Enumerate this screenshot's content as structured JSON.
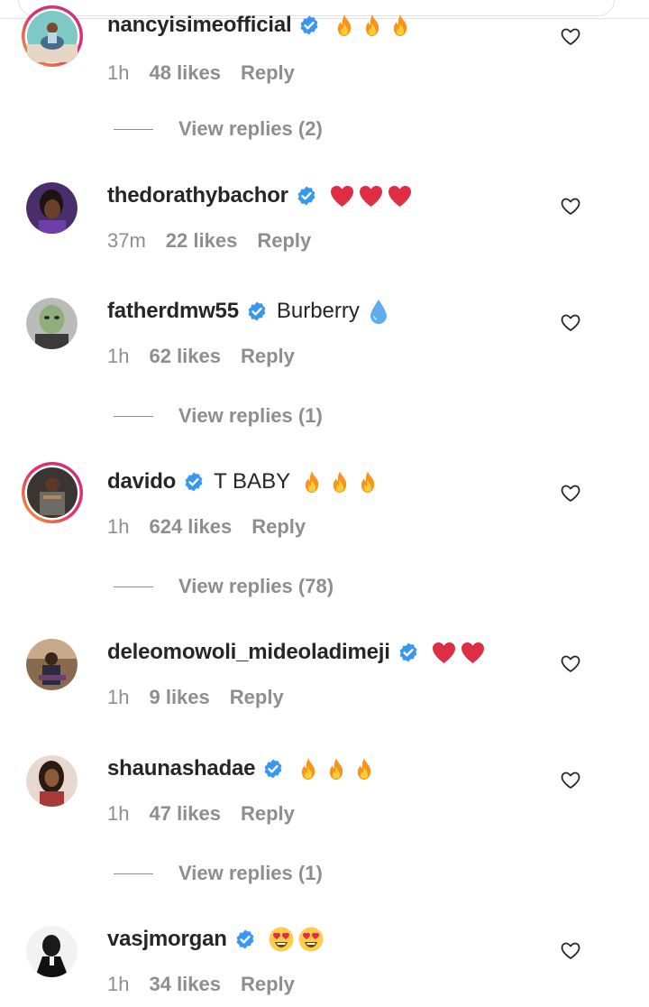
{
  "colors": {
    "text": "#262626",
    "muted": "#8e8e8e",
    "verified": "#3897f0",
    "ring": "#d6249f"
  },
  "comments": [
    {
      "username": "nancyisimeofficial",
      "verified": true,
      "text": "",
      "emojis": [
        "fire",
        "fire",
        "fire"
      ],
      "time": "1h",
      "likes": "48 likes",
      "reply": "Reply",
      "view_replies": "View replies (2)",
      "story_ring": true
    },
    {
      "username": "thedorathybachor",
      "verified": true,
      "text": "",
      "emojis": [
        "red-heart",
        "red-heart",
        "red-heart"
      ],
      "time": "37m",
      "likes": "22 likes",
      "reply": "Reply",
      "view_replies": "",
      "story_ring": false
    },
    {
      "username": "fatherdmw55",
      "verified": true,
      "text": "Burberry",
      "emojis": [
        "droplet"
      ],
      "time": "1h",
      "likes": "62 likes",
      "reply": "Reply",
      "view_replies": "View replies (1)",
      "story_ring": false
    },
    {
      "username": "davido",
      "verified": true,
      "text": "T BABY",
      "emojis": [
        "fire",
        "fire",
        "fire"
      ],
      "time": "1h",
      "likes": "624 likes",
      "reply": "Reply",
      "view_replies": "View replies (78)",
      "story_ring": true
    },
    {
      "username": "deleomowoli_mideoladimeji",
      "verified": true,
      "text": "",
      "emojis": [
        "red-heart",
        "red-heart"
      ],
      "time": "1h",
      "likes": "9 likes",
      "reply": "Reply",
      "view_replies": "",
      "story_ring": false
    },
    {
      "username": "shaunashadae",
      "verified": true,
      "text": "",
      "emojis": [
        "fire",
        "fire",
        "fire"
      ],
      "time": "1h",
      "likes": "47 likes",
      "reply": "Reply",
      "view_replies": "View replies (1)",
      "story_ring": false
    },
    {
      "username": "vasjmorgan",
      "verified": true,
      "text": "",
      "emojis": [
        "heart-eyes",
        "heart-eyes"
      ],
      "time": "1h",
      "likes": "34 likes",
      "reply": "Reply",
      "view_replies": "",
      "story_ring": false
    }
  ]
}
